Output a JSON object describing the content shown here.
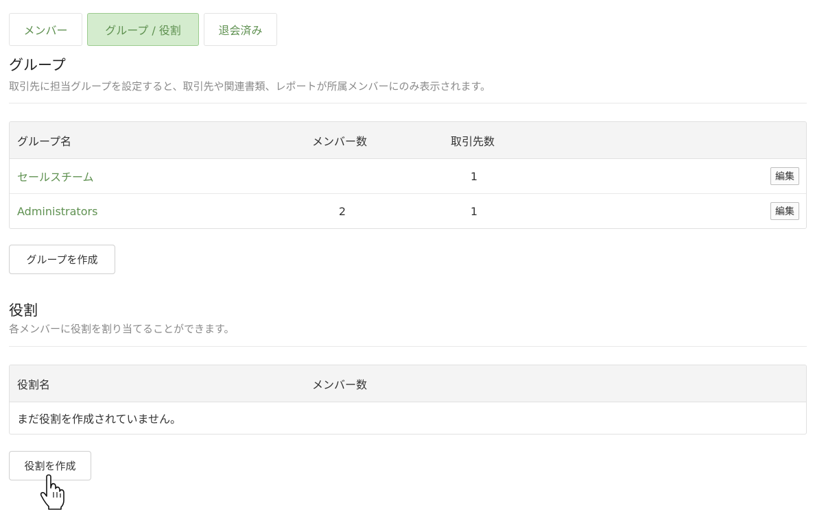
{
  "tabs": [
    {
      "label": "メンバー",
      "active": false
    },
    {
      "label": "グループ / 役割",
      "active": true
    },
    {
      "label": "退会済み",
      "active": false
    }
  ],
  "groups": {
    "title": "グループ",
    "description": "取引先に担当グループを設定すると、取引先や関連書類、レポートが所属メンバーにのみ表示されます。",
    "columns": {
      "name": "グループ名",
      "members": "メンバー数",
      "clients": "取引先数"
    },
    "rows": [
      {
        "name": "セールスチーム",
        "members": "",
        "clients": "1",
        "edit": "編集"
      },
      {
        "name": "Administrators",
        "members": "2",
        "clients": "1",
        "edit": "編集"
      }
    ],
    "create_button": "グループを作成"
  },
  "roles": {
    "title": "役割",
    "description": "各メンバーに役割を割り当てることができます。",
    "columns": {
      "name": "役割名",
      "members": "メンバー数"
    },
    "empty_message": "まだ役割を作成されていません。",
    "create_button": "役割を作成"
  },
  "colors": {
    "accent_green": "#5f9151",
    "active_tab_bg": "#d4ecce"
  },
  "cursor_icon": "hand-pointer-icon"
}
